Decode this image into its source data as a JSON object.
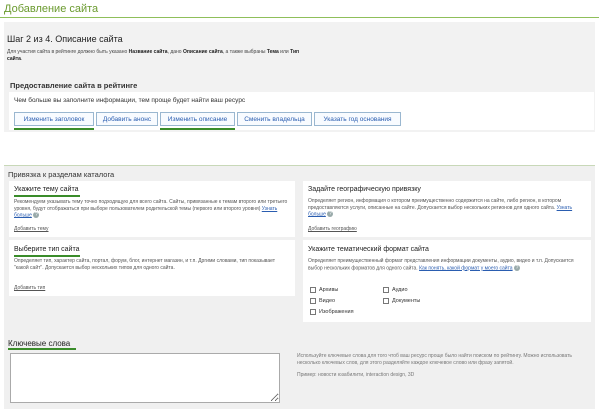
{
  "page": {
    "title": "Добавление сайта"
  },
  "step": {
    "title": "Шаг 2 из 4. Описание сайта",
    "desc_pre": "Для участия сайта в рейтинге должно быть указано ",
    "desc_b1": "Название сайта",
    "desc_mid": ", дано ",
    "desc_b2": "Описание сайта",
    "desc_mid2": ", а также выбраны ",
    "desc_b3": "Тема",
    "desc_and": " или ",
    "desc_b4": "Тип сайта",
    "desc_end": "."
  },
  "promo": {
    "heading": "Предоставление сайта в рейтинге",
    "text": "Чем больше вы заполните информации, тем проще будет найти ваш ресурс",
    "buttons": [
      {
        "label": "Изменить заголовок"
      },
      {
        "label": "Добавить анонс"
      },
      {
        "label": "Изменить описание"
      },
      {
        "label": "Сменить владельца"
      },
      {
        "label": "Указать год основания"
      }
    ]
  },
  "catalog": {
    "heading": "Привязка к разделам каталога",
    "theme": {
      "title": "Укажите тему сайта",
      "text": "Рекомендуем указывать тему точно подходящую для всего сайта. Сайты, привязанные к темам второго или третьего уровня, будут отображаться при выборе пользователем родительской темы (первого или второго уровня)",
      "more": "Узнать больше",
      "add": "Добавить тему"
    },
    "type": {
      "title": "Выберите тип сайта",
      "text": "Определяет тип, характер сайта, портал, форум, блог, интернет магазин, и т.п. Дргими словами, тип показывает \"какой сайт\". Допускается выбор нескольких типов для одного сайта.",
      "add": "Добавить тип"
    },
    "geo": {
      "title": "Задайте географическую привязку",
      "text": "Определяет регион, информация о котором преимущественно содержится на сайте, либо регион, в котором предоставляются услуги, описанные на сайте. Допускается выбор нескольких регионов для одного сайта.",
      "more": "Узнать больше",
      "add": "Добавить географию"
    },
    "format": {
      "title": "Укажите тематический формат сайта",
      "text": "Определяет преимущественный формат представления информации документы, аудио, видео и т.п. Допускается выбор нескольких форматов для одного сайта.",
      "more": "Как понять, какой формат у моего сайта",
      "options": [
        "Архивы",
        "Аудио",
        "Видео",
        "Документы",
        "Изображения"
      ]
    }
  },
  "keywords": {
    "heading": "Ключевые слова",
    "value": "",
    "hint": "Используйте ключевые слова для того чтоб ваш ресурс проще было найти поиском по рейтингу. Можно использовать несколько ключевых слов, для этого разделяйте каждое ключевое слово или фразу запятой.",
    "example": "Пример: новости юзабилити, interaction design, 3D"
  },
  "colors": {
    "accent_green": "#6a9a2e",
    "link_blue": "#2a5db0",
    "underline_green": "#3a8c2a"
  }
}
